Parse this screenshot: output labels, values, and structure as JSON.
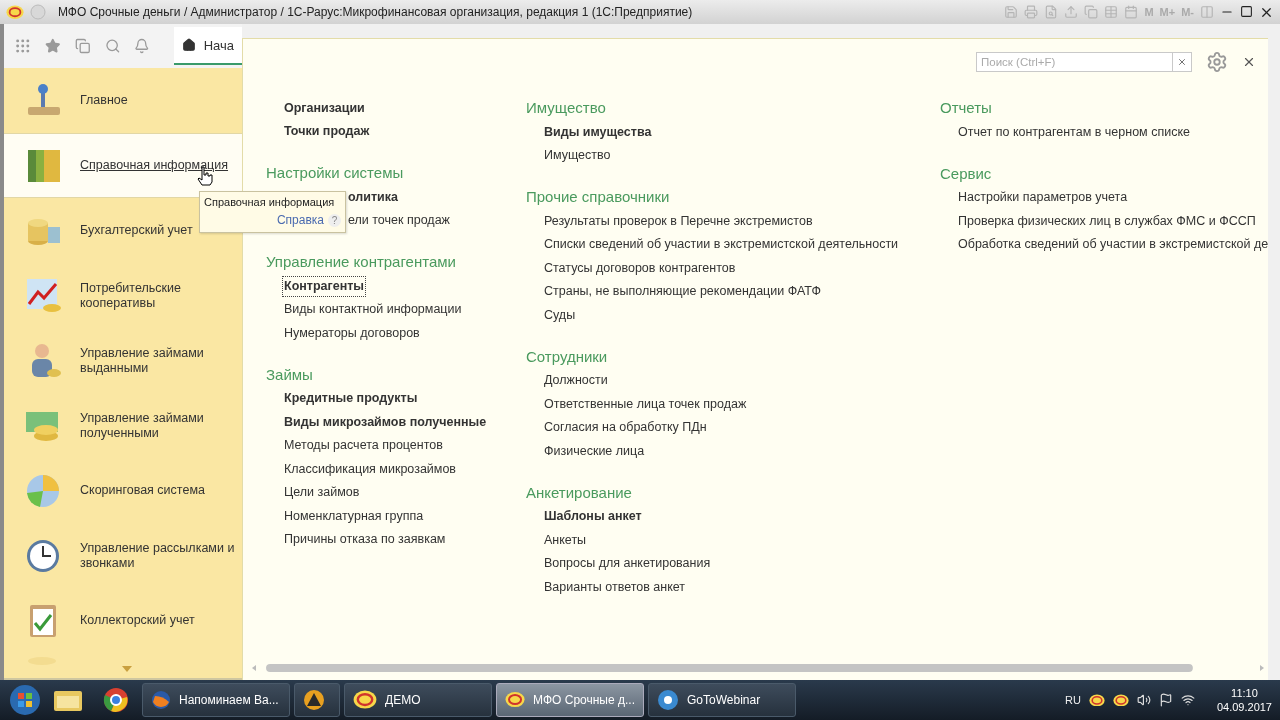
{
  "window": {
    "title": "МФО Срочные деньги / Администратор / 1С-Рарус:Микрофинансовая организация, редакция 1  (1С:Предприятие)",
    "memory_buttons": [
      "M",
      "M+",
      "M-"
    ]
  },
  "home_tab": {
    "label": "Нача",
    "selected": true
  },
  "sidebar": {
    "items": [
      {
        "label": "Главное",
        "selected": false
      },
      {
        "label": "Справочная информация",
        "selected": true
      },
      {
        "label": "Бухгалтерский учет",
        "selected": false
      },
      {
        "label": "Потребительские кооперативы",
        "selected": false
      },
      {
        "label": "Управление займами выданными",
        "selected": false
      },
      {
        "label": "Управление займами полученными",
        "selected": false
      },
      {
        "label": "Скоринговая система",
        "selected": false
      },
      {
        "label": "Управление рассылками и звонками",
        "selected": false
      },
      {
        "label": "Коллекторский учет",
        "selected": false
      }
    ]
  },
  "tooltip": {
    "title": "Справочная информация",
    "link": "Справка",
    "help": "?"
  },
  "search": {
    "placeholder": "Поиск (Ctrl+F)"
  },
  "columns": [
    [
      {
        "items": [
          {
            "label": "Организации",
            "bold": true
          },
          {
            "label": "Точки продаж",
            "bold": true
          }
        ]
      },
      {
        "heading": "Настройки системы",
        "items": [
          {
            "label": "олитика",
            "bold": true,
            "kind": "cut"
          },
          {
            "label": "ели точек продаж",
            "bold": false,
            "kind": "cut"
          }
        ]
      },
      {
        "heading": "Управление контрагентами",
        "items": [
          {
            "label": "Контрагенты",
            "bold": true,
            "focused": true
          },
          {
            "label": "Виды контактной информации",
            "bold": false
          },
          {
            "label": "Нумераторы договоров",
            "bold": false
          }
        ]
      },
      {
        "heading": "Займы",
        "items": [
          {
            "label": "Кредитные продукты",
            "bold": true
          },
          {
            "label": "Виды микрозаймов полученные",
            "bold": true
          },
          {
            "label": "Методы расчета процентов",
            "bold": false
          },
          {
            "label": "Классификация микрозаймов",
            "bold": false
          },
          {
            "label": "Цели займов",
            "bold": false
          },
          {
            "label": "Номенклатурная группа",
            "bold": false
          },
          {
            "label": "Причины отказа по заявкам",
            "bold": false
          }
        ]
      }
    ],
    [
      {
        "heading": "Имущество",
        "items": [
          {
            "label": "Виды имущества",
            "bold": true
          },
          {
            "label": "Имущество",
            "bold": false
          }
        ]
      },
      {
        "heading": "Прочие справочники",
        "items": [
          {
            "label": "Результаты проверок в Перечне экстремистов",
            "bold": false
          },
          {
            "label": "Списки сведений об участии в экстремистской деятельности",
            "bold": false
          },
          {
            "label": "Статусы договоров контрагентов",
            "bold": false
          },
          {
            "label": "Страны, не выполняющие рекомендации ФАТФ",
            "bold": false
          },
          {
            "label": "Суды",
            "bold": false
          }
        ]
      },
      {
        "heading": "Сотрудники",
        "items": [
          {
            "label": "Должности",
            "bold": false
          },
          {
            "label": "Ответственные лица точек продаж",
            "bold": false
          },
          {
            "label": "Согласия на обработку ПДн",
            "bold": false
          },
          {
            "label": "Физические лица",
            "bold": false
          }
        ]
      },
      {
        "heading": "Анкетирование",
        "items": [
          {
            "label": "Шаблоны анкет",
            "bold": true
          },
          {
            "label": "Анкеты",
            "bold": false
          },
          {
            "label": "Вопросы для анкетирования",
            "bold": false
          },
          {
            "label": "Варианты ответов анкет",
            "bold": false
          }
        ]
      }
    ],
    [
      {
        "heading": "Отчеты",
        "items": [
          {
            "label": "Отчет по контрагентам в черном списке",
            "bold": false
          }
        ]
      },
      {
        "heading": "Сервис",
        "items": [
          {
            "label": "Настройки параметров учета",
            "bold": false
          },
          {
            "label": "Проверка физических лиц в службах ФМС и ФССП",
            "bold": false
          },
          {
            "label": "Обработка сведений об участии в экстремистской де",
            "bold": false
          }
        ]
      }
    ]
  ],
  "taskbar": {
    "buttons": [
      {
        "label": "Напоминаем Ва...",
        "kind": "browser",
        "selected": false
      },
      {
        "kind": "app",
        "selected": false
      },
      {
        "label": "ДЕМО",
        "kind": "onec",
        "selected": false
      },
      {
        "label": "МФО Срочные д...",
        "kind": "onec",
        "selected": true
      },
      {
        "label": "GoToWebinar",
        "kind": "webinar",
        "selected": false
      }
    ],
    "language": "RU",
    "time": "11:10",
    "date": "04.09.2017"
  }
}
